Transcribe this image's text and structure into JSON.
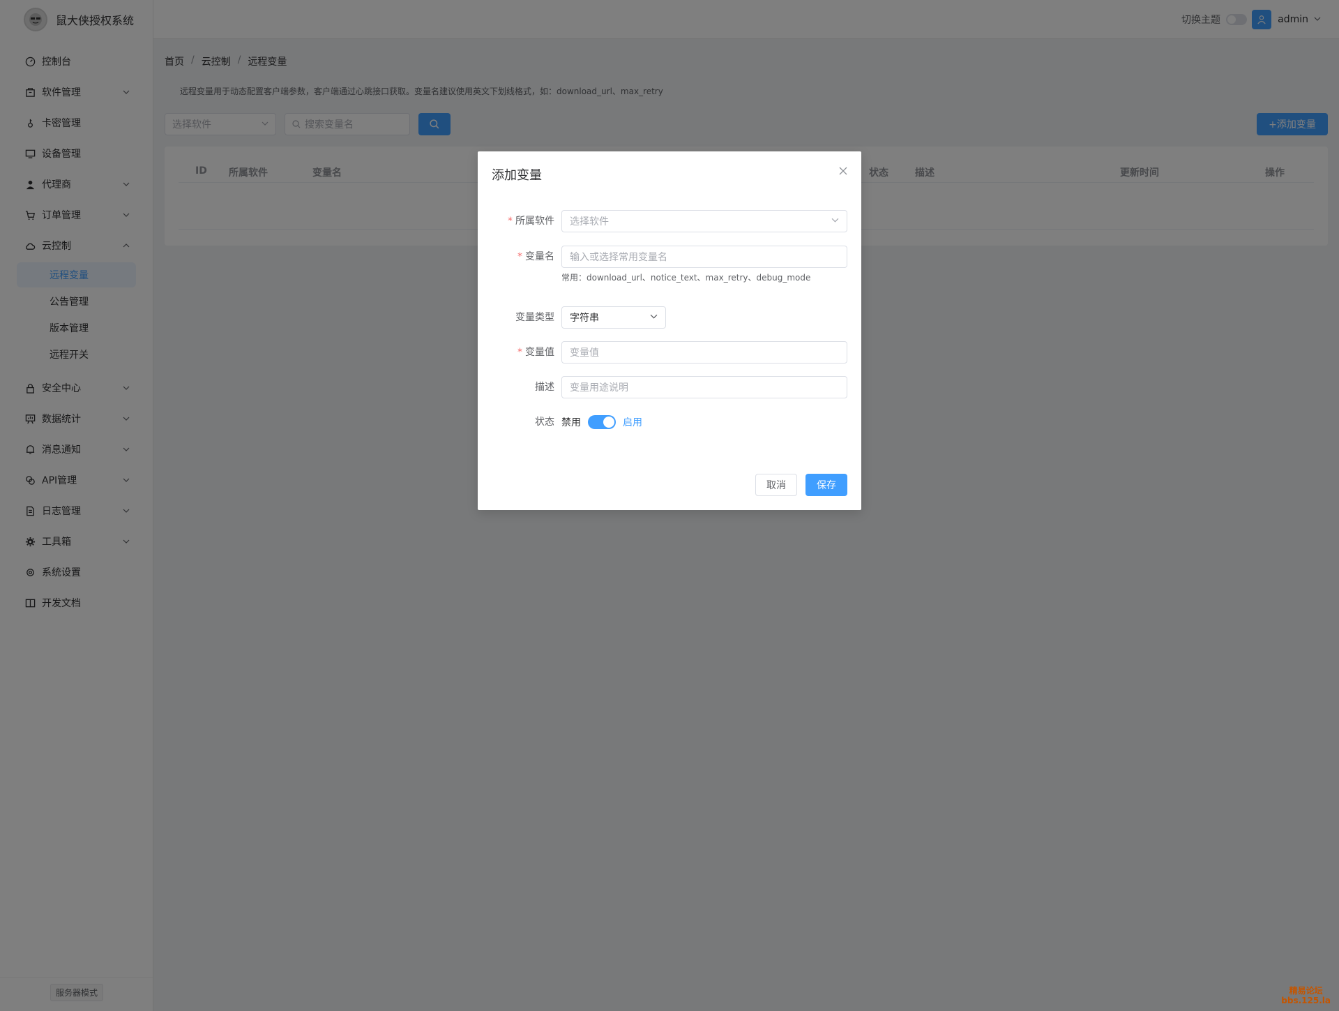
{
  "brand": {
    "title": "鼠大侠授权系统",
    "logo_icon": "logo-face-icon"
  },
  "sidebar": {
    "items": [
      {
        "label": "控制台",
        "icon": "dashboard-icon",
        "has_arrow": false
      },
      {
        "label": "软件管理",
        "icon": "package-icon",
        "has_arrow": true
      },
      {
        "label": "卡密管理",
        "icon": "key-icon",
        "has_arrow": false
      },
      {
        "label": "设备管理",
        "icon": "monitor-icon",
        "has_arrow": false
      },
      {
        "label": "代理商",
        "icon": "user-icon",
        "has_arrow": true
      },
      {
        "label": "订单管理",
        "icon": "cart-icon",
        "has_arrow": true
      },
      {
        "label": "云控制",
        "icon": "cloud-icon",
        "has_arrow": true,
        "expanded": true
      }
    ],
    "cloud_sub": [
      {
        "label": "远程变量",
        "active": true
      },
      {
        "label": "公告管理",
        "active": false
      },
      {
        "label": "版本管理",
        "active": false
      },
      {
        "label": "远程开关",
        "active": false
      }
    ],
    "items_after": [
      {
        "label": "安全中心",
        "icon": "lock-icon"
      },
      {
        "label": "数据统计",
        "icon": "chart-icon"
      },
      {
        "label": "消息通知",
        "icon": "bell-icon"
      },
      {
        "label": "API管理",
        "icon": "api-icon"
      },
      {
        "label": "日志管理",
        "icon": "document-icon"
      },
      {
        "label": "工具箱",
        "icon": "gear-icon"
      },
      {
        "label": "系统设置",
        "icon": "settings-icon",
        "no_arrow": true
      },
      {
        "label": "开发文档",
        "icon": "book-icon",
        "no_arrow": true
      }
    ],
    "server_mode": "服务器模式"
  },
  "header": {
    "theme_label": "切换主题",
    "user_name": "admin"
  },
  "breadcrumb": [
    "首页",
    "云控制",
    "远程变量"
  ],
  "tip": "远程变量用于动态配置客户端参数，客户端通过心跳接口获取。变量名建议使用英文下划线格式，如：download_url、max_retry",
  "toolbar": {
    "software_placeholder": "选择软件",
    "search_placeholder": "搜索变量名",
    "add_label": "+添加变量"
  },
  "table": {
    "columns": [
      "ID",
      "所属软件",
      "变量名",
      "状态",
      "描述",
      "更新时间",
      "操作"
    ]
  },
  "dialog": {
    "title": "添加变量",
    "software_label": "所属软件",
    "software_placeholder": "选择软件",
    "name_label": "变量名",
    "name_placeholder": "输入或选择常用变量名",
    "name_hint": "常用：download_url、notice_text、max_retry、debug_mode",
    "type_label": "变量类型",
    "type_value": "字符串",
    "value_label": "变量值",
    "value_placeholder": "变量值",
    "desc_label": "描述",
    "desc_placeholder": "变量用途说明",
    "status_label": "状态",
    "status_off": "禁用",
    "status_on": "启用",
    "status_enabled": true,
    "cancel_label": "取消",
    "save_label": "保存"
  },
  "watermark": {
    "line1": "精易论坛",
    "line2": "bbs.125.la"
  },
  "colors": {
    "primary": "#409eff",
    "required": "#f56c6c"
  }
}
